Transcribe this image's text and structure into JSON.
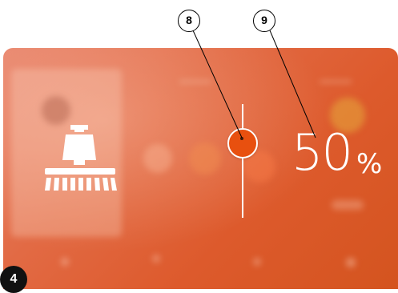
{
  "panel_number": "4",
  "callouts": [
    {
      "label": "8"
    },
    {
      "label": "9"
    }
  ],
  "brush_control": {
    "icon": "floor-brush-icon",
    "level_fraction": 0.5
  },
  "readout": {
    "value": "50",
    "unit": "%"
  },
  "colors": {
    "accent": "#e8500f",
    "panel_base": "#dd5a2c",
    "foreground": "#ffffff"
  }
}
